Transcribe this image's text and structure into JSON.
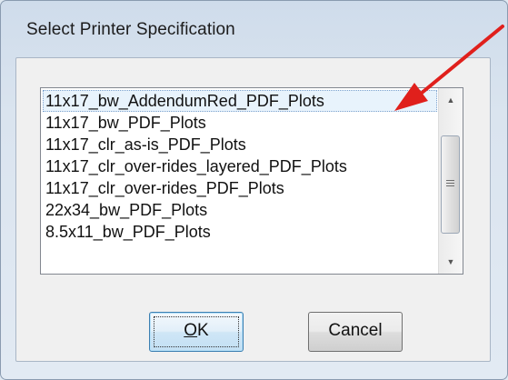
{
  "dialog": {
    "title": "Select Printer Specification"
  },
  "list": {
    "items": [
      "11x17_bw_AddendumRed_PDF_Plots",
      "11x17_bw_PDF_Plots",
      "11x17_clr_as-is_PDF_Plots",
      "11x17_clr_over-rides_layered_PDF_Plots",
      "11x17_clr_over-rides_PDF_Plots",
      "22x34_bw_PDF_Plots",
      "8.5x11_bw_PDF_Plots"
    ],
    "selected_index": 0
  },
  "buttons": {
    "ok_mnemonic": "O",
    "ok_rest": "K",
    "cancel_label": "Cancel"
  },
  "icons": {
    "scroll_up": "scroll-up-arrow",
    "scroll_down": "scroll-down-arrow",
    "scroll_grip": "grip",
    "annotation": "red-arrow"
  },
  "colors": {
    "annotation_arrow": "#e0201c",
    "selection_fill": "#e8f3fc",
    "default_button_border": "#3c7fb1"
  }
}
